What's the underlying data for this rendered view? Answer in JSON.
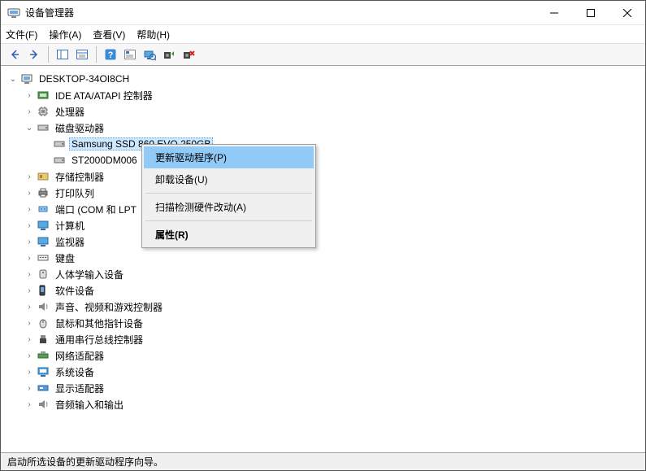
{
  "window": {
    "title": "设备管理器"
  },
  "menu": {
    "file": "文件(F)",
    "action": "操作(A)",
    "view": "查看(V)",
    "help": "帮助(H)"
  },
  "tree": {
    "root": "DESKTOP-34OI8CH",
    "ide": "IDE ATA/ATAPI 控制器",
    "cpu": "处理器",
    "disk": "磁盘驱动器",
    "disk0": "Samsung SSD 860 EVO 250GB",
    "disk1": "ST2000DM006",
    "storage": "存储控制器",
    "printq": "打印队列",
    "ports": "端口 (COM 和 LPT",
    "computer": "计算机",
    "monitor": "监视器",
    "keyboard": "键盘",
    "hid": "人体学输入设备",
    "software": "软件设备",
    "sound": "声音、视频和游戏控制器",
    "mouse": "鼠标和其他指针设备",
    "usb": "通用串行总线控制器",
    "network": "网络适配器",
    "system": "系统设备",
    "display": "显示适配器",
    "audio": "音频输入和输出"
  },
  "contextmenu": {
    "update": "更新驱动程序(P)",
    "uninstall": "卸载设备(U)",
    "scan": "扫描检测硬件改动(A)",
    "properties": "属性(R)"
  },
  "status": {
    "text": "启动所选设备的更新驱动程序向导。"
  }
}
